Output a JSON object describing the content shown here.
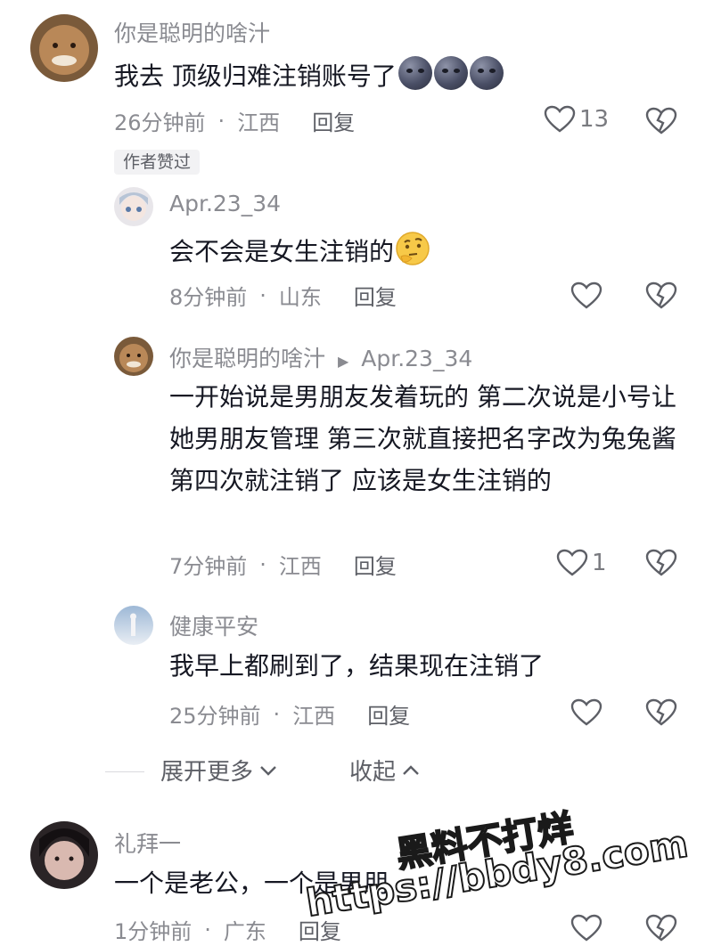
{
  "comments": [
    {
      "author": "你是聪明的啥汁",
      "text": "我去 顶级归难注销账号了",
      "emoji": "new-moon-face-emoji x3",
      "time": "26分钟前",
      "location": "江西",
      "reply_label": "回复",
      "likes": "13",
      "tag": "作者赞过"
    },
    {
      "author": "Apr.23_34",
      "text": "会不会是女生注销的",
      "emoji": "thinking-face-emoji",
      "time": "8分钟前",
      "location": "山东",
      "reply_label": "回复",
      "likes": ""
    },
    {
      "author": "你是聪明的啥汁",
      "reply_to": "Apr.23_34",
      "text": "一开始说是男朋友发着玩的 第二次说是小号让她男朋友管理 第三次就直接把名字改为兔兔酱 第四次就注销了 应该是女生注销的",
      "time": "7分钟前",
      "location": "江西",
      "reply_label": "回复",
      "likes": "1"
    },
    {
      "author": "健康平安",
      "text": "我早上都刷到了，结果现在注销了",
      "time": "25分钟前",
      "location": "江西",
      "reply_label": "回复",
      "likes": ""
    },
    {
      "author": "礼拜一",
      "text": "一个是老公，一个是男朋",
      "time": "1分钟前",
      "location": "广东",
      "reply_label": "回复",
      "likes": ""
    }
  ],
  "expand": {
    "more_label": "展开更多",
    "collapse_label": "收起"
  },
  "watermark": {
    "line1": "黑料不打烊",
    "line2": "https://bbdy8.com"
  },
  "colors": {
    "text": "#161823",
    "meta": "#8a8b91",
    "bg": "#ffffff"
  }
}
